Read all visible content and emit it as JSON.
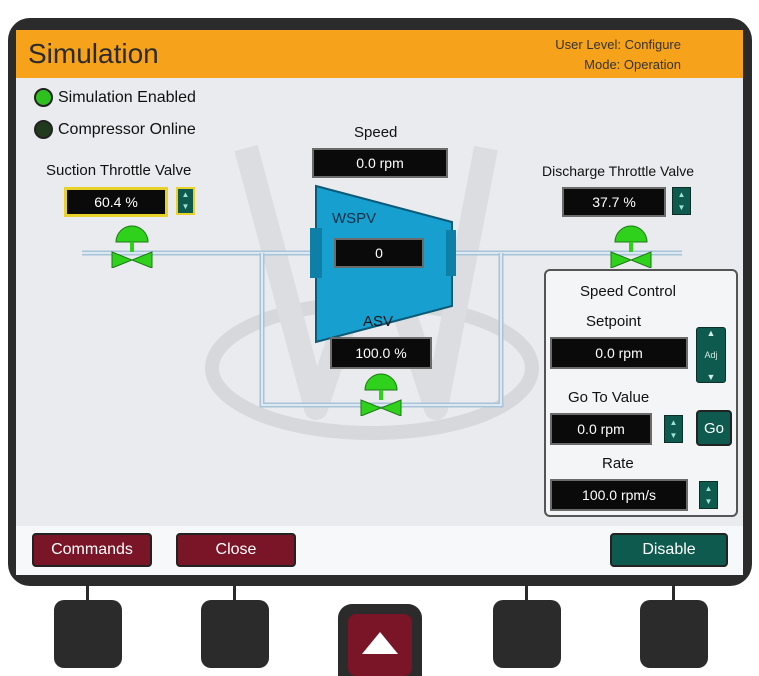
{
  "header": {
    "title": "Simulation",
    "user_level": "User Level: Configure",
    "mode": "Mode: Operation"
  },
  "indicators": [
    {
      "label": "Simulation Enabled",
      "color": "#2ec01f"
    },
    {
      "label": "Compressor Online",
      "color": "#1f3a1c"
    }
  ],
  "suction_valve": {
    "label": "Suction Throttle Valve",
    "value": "60.4 %"
  },
  "discharge_valve": {
    "label": "Discharge Throttle Valve",
    "value": "37.7 %"
  },
  "speed": {
    "label": "Speed",
    "value": "0.0 rpm"
  },
  "wspv": {
    "label": "WSPV",
    "value": "0"
  },
  "asv": {
    "label": "ASV",
    "value": "100.0 %"
  },
  "speed_control": {
    "title": "Speed Control",
    "setpoint_label": "Setpoint",
    "setpoint_value": "0.0 rpm",
    "adj_label": "Adj",
    "goto_label": "Go To Value",
    "goto_value": "0.0 rpm",
    "go_label": "Go",
    "rate_label": "Rate",
    "rate_value": "100.0 rpm/s"
  },
  "footer": {
    "commands": "Commands",
    "close": "Close",
    "disable": "Disable"
  },
  "colors": {
    "accent": "#f7a21b",
    "valve": "#2fd11d",
    "red_button": "#7a1427",
    "green_button": "#0f5a4e"
  }
}
